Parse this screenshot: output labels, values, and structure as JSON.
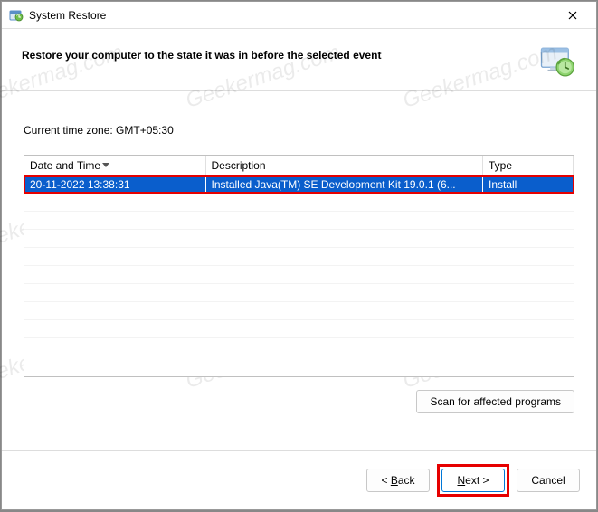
{
  "window": {
    "title": "System Restore"
  },
  "header": {
    "title": "Restore your computer to the state it was in before the selected event"
  },
  "timezone": {
    "label": "Current time zone: GMT+05:30"
  },
  "table": {
    "columns": {
      "date": "Date and Time",
      "description": "Description",
      "type": "Type"
    },
    "rows": [
      {
        "date": "20-11-2022 13:38:31",
        "description": "Installed Java(TM) SE Development Kit 19.0.1 (6...",
        "type": "Install"
      }
    ]
  },
  "buttons": {
    "scan": "Scan for affected programs",
    "back_prefix": "< ",
    "back_u": "B",
    "back_rest": "ack",
    "next_u": "N",
    "next_rest": "ext >",
    "cancel": "Cancel"
  },
  "watermark": "Geekermag.com"
}
